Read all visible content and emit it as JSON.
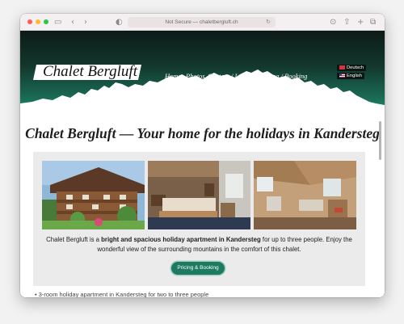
{
  "browser": {
    "url": "Not Secure — chaletbergluft.ch"
  },
  "site": {
    "logo": "Chalet Bergluft",
    "nav": [
      {
        "label": "Home",
        "active": true
      },
      {
        "label": "Photos",
        "active": false
      },
      {
        "label": "Contact / Location",
        "active": false
      },
      {
        "label": "Pricing / Booking",
        "active": false
      }
    ],
    "languages": [
      {
        "label": "Deutsch",
        "flag": "de-flag-icon"
      },
      {
        "label": "English",
        "flag": "us-flag-icon"
      }
    ]
  },
  "main": {
    "headline": "Chalet Bergluft — Your home for the holidays in Kandersteg",
    "photos": [
      "chalet-exterior-photo",
      "bedroom-photo",
      "living-room-photo"
    ],
    "description": {
      "part1": "Chalet Bergluft is a ",
      "bold": "bright and spacious holiday apartment in Kandersteg",
      "part2": " for up to three people. Enjoy the wonderful view of the surrounding mountains in the comfort of this chalet."
    },
    "cta_label": "Pricing & Booking",
    "bullet_partial": "3-room holiday apartment in Kandersteg for two to three people"
  },
  "colors": {
    "accent": "#1f7a62",
    "header_dark": "#0d1a17",
    "header_teal": "#1e8a6c"
  }
}
